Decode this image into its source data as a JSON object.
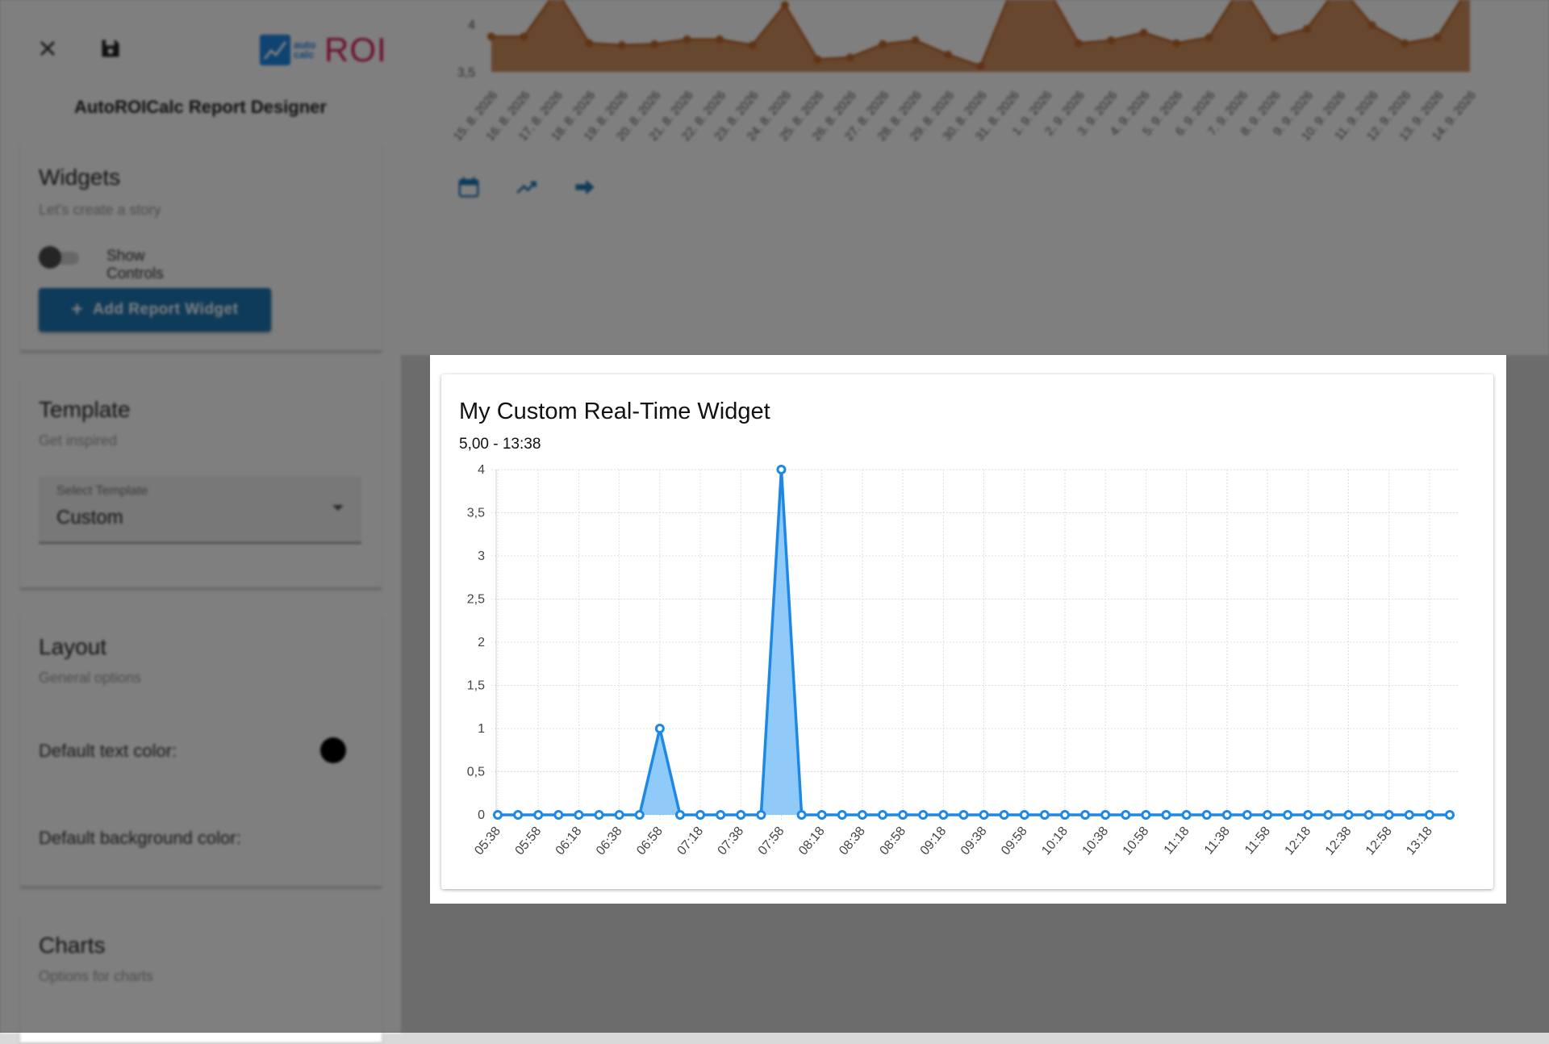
{
  "app": {
    "title": "AutoROICalc Report Designer",
    "logo_small": "auto calc",
    "logo_text": "ROI"
  },
  "icons": {
    "close": "close-icon",
    "save": "floppy-disk-icon",
    "calendar": "calendar-icon",
    "trend": "trending-up-icon",
    "arrow": "arrow-right-icon"
  },
  "widgets_panel": {
    "title": "Widgets",
    "subtitle": "Let's create a story",
    "toggle_label": "Show Controls",
    "add_button": "Add Report Widget"
  },
  "template_panel": {
    "title": "Template",
    "subtitle": "Get inspired",
    "select_label": "Select Template",
    "select_value": "Custom"
  },
  "layout_panel": {
    "title": "Layout",
    "subtitle": "General options",
    "text_color_label": "Default text color:",
    "text_color": "#000000",
    "bg_color_label": "Default background color:"
  },
  "charts_panel": {
    "title": "Charts",
    "subtitle": "Options for charts"
  },
  "background_chart": {
    "type": "area",
    "color": "#c0682a",
    "y_tick_labels": [
      "4",
      "3,5"
    ],
    "x": [
      "15. 8. 2026",
      "16. 8. 2026",
      "17. 8. 2026",
      "18. 8. 2026",
      "19. 8. 2026",
      "20. 8. 2026",
      "21. 8. 2026",
      "22. 8. 2026",
      "23. 8. 2026",
      "24. 8. 2026",
      "25. 8. 2026",
      "26. 8. 2026",
      "27. 8. 2026",
      "28. 8. 2026",
      "29. 8. 2026",
      "30. 8. 2026",
      "31. 8. 2026",
      "1. 9. 2026",
      "2. 9. 2026",
      "3. 9. 2026",
      "4. 9. 2026",
      "5. 9. 2026",
      "6. 9. 2026",
      "7. 9. 2026",
      "8. 9. 2026",
      "9. 9. 2026",
      "10. 9. 2026",
      "11. 9. 2026",
      "12. 9. 2026",
      "13. 9. 2026",
      "14. 9. 2026"
    ],
    "values": [
      3.87,
      3.87,
      4.35,
      3.8,
      3.78,
      3.79,
      3.84,
      3.84,
      3.78,
      4.2,
      3.63,
      3.65,
      3.79,
      3.83,
      3.68,
      3.56,
      4.4,
      4.4,
      3.8,
      3.83,
      3.91,
      3.8,
      3.86,
      4.4,
      3.86,
      3.95,
      4.4,
      3.99,
      3.8,
      3.86,
      4.4
    ]
  },
  "widget": {
    "title": "My Custom Real-Time Widget",
    "subtitle": "5,00 - 13:38"
  },
  "chart_data": {
    "type": "area",
    "title": "My Custom Real-Time Widget",
    "subtitle": "5,00 - 13:38",
    "line_color": "#1e88e5",
    "fill_color": "#90caf9",
    "ylim": [
      0,
      4
    ],
    "y_ticks": [
      "0",
      "0,5",
      "1",
      "1,5",
      "2",
      "2,5",
      "3",
      "3,5",
      "4"
    ],
    "grid": true,
    "x_tick_labels": [
      "05:38",
      "05:58",
      "06:18",
      "06:38",
      "06:58",
      "07:18",
      "07:38",
      "07:58",
      "08:18",
      "08:38",
      "08:58",
      "09:18",
      "09:38",
      "09:58",
      "10:18",
      "10:38",
      "10:58",
      "11:18",
      "11:38",
      "11:58",
      "12:18",
      "12:38",
      "12:58",
      "13:18"
    ],
    "x": [
      "05:38",
      "05:48",
      "05:58",
      "06:08",
      "06:18",
      "06:28",
      "06:38",
      "06:48",
      "06:58",
      "07:08",
      "07:18",
      "07:28",
      "07:38",
      "07:48",
      "07:58",
      "08:08",
      "08:18",
      "08:28",
      "08:38",
      "08:48",
      "08:58",
      "09:08",
      "09:18",
      "09:28",
      "09:38",
      "09:48",
      "09:58",
      "10:08",
      "10:18",
      "10:28",
      "10:38",
      "10:48",
      "10:58",
      "11:08",
      "11:18",
      "11:28",
      "11:38",
      "11:48",
      "11:58",
      "12:08",
      "12:18",
      "12:28",
      "12:38",
      "12:48",
      "12:58",
      "13:08",
      "13:18",
      "13:28"
    ],
    "values": [
      0,
      0,
      0,
      0,
      0,
      0,
      0,
      0,
      1,
      0,
      0,
      0,
      0,
      0,
      4,
      0,
      0,
      0,
      0,
      0,
      0,
      0,
      0,
      0,
      0,
      0,
      0,
      0,
      0,
      0,
      0,
      0,
      0,
      0,
      0,
      0,
      0,
      0,
      0,
      0,
      0,
      0,
      0,
      0,
      0,
      0,
      0,
      0
    ]
  }
}
